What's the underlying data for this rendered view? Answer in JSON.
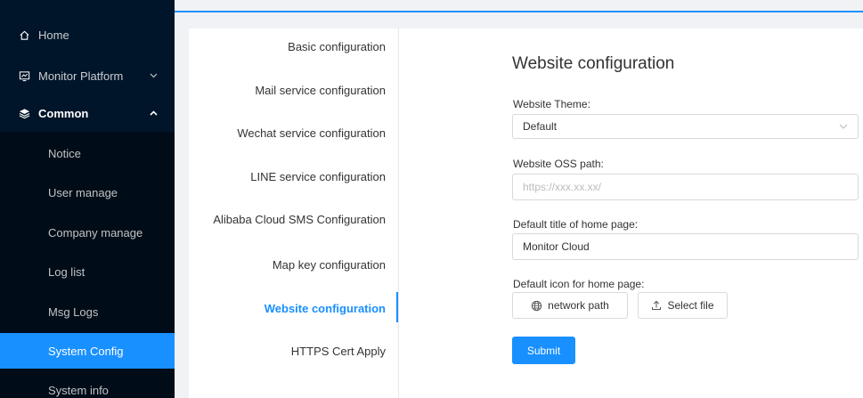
{
  "sidebar": {
    "items": [
      {
        "label": "Home",
        "icon": "home-icon"
      },
      {
        "label": "Monitor Platform",
        "icon": "monitor-icon"
      },
      {
        "label": "Common",
        "icon": "layers-icon"
      }
    ],
    "common_children": [
      {
        "label": "Notice"
      },
      {
        "label": "User manage"
      },
      {
        "label": "Company manage"
      },
      {
        "label": "Log list"
      },
      {
        "label": "Msg Logs"
      },
      {
        "label": "System Config",
        "active": true
      },
      {
        "label": "System info"
      }
    ]
  },
  "tabs": [
    {
      "label": "Basic configuration"
    },
    {
      "label": "Mail service configuration"
    },
    {
      "label": "Wechat service configuration"
    },
    {
      "label": "LINE service configuration"
    },
    {
      "label": "Alibaba Cloud SMS Configuration"
    },
    {
      "label": "Map key configuration"
    },
    {
      "label": "Website configuration",
      "active": true
    },
    {
      "label": "HTTPS Cert Apply"
    }
  ],
  "form": {
    "title": "Website configuration",
    "theme_label": "Website Theme:",
    "theme_value": "Default",
    "oss_label": "Website OSS path:",
    "oss_placeholder": "https://xxx.xx.xx/",
    "home_title_label": "Default title of home page:",
    "home_title_value": "Monitor Cloud",
    "home_icon_label": "Default icon for home page:",
    "network_path_button": "network path",
    "select_file_button": "Select file",
    "submit_button": "Submit"
  },
  "colors": {
    "accent": "#1890ff",
    "sidebar_bg": "#001529",
    "submenu_bg": "#000c17"
  }
}
